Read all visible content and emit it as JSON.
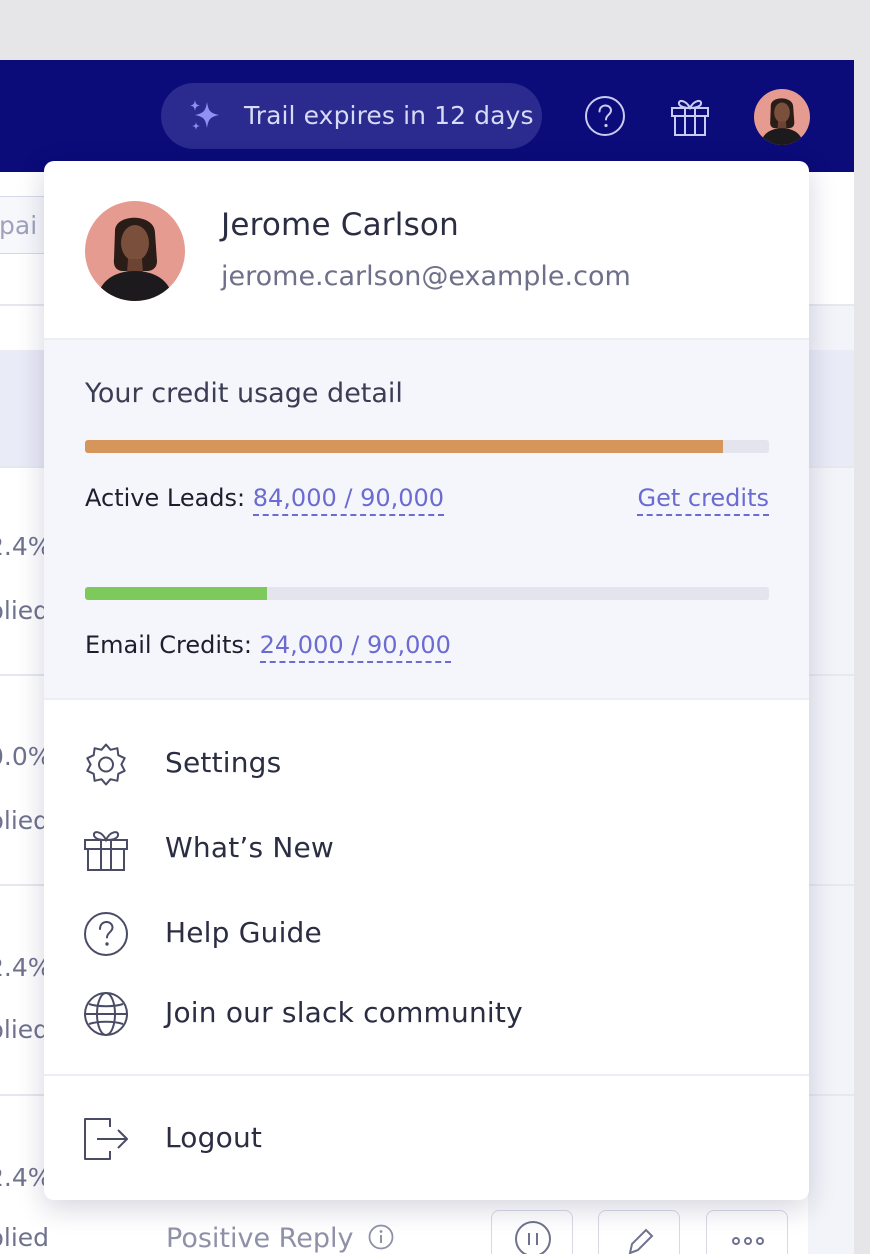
{
  "topbar": {
    "trial_label": "Trail expires in 12 days",
    "help_icon": "help-circle-icon",
    "gift_icon": "gift-icon",
    "colors": {
      "bar": "#0b0b79",
      "pill": "#2a2a8f",
      "sparkle": "#8f8ff5"
    }
  },
  "background": {
    "search_text": "pai",
    "row_texts": [
      "2.4%",
      "plied",
      "0.0%",
      "plied",
      "2.4%",
      "plied",
      "2.4%",
      "plied"
    ],
    "status_label": "Positive Reply"
  },
  "user": {
    "name": "Jerome Carlson",
    "email": "jerome.carlson@example.com"
  },
  "credits": {
    "heading": "Your credit usage detail",
    "active_leads": {
      "label": "Active Leads:",
      "value": "84,000 / 90,000",
      "used": 84000,
      "total": 90000,
      "color": "#d6955a"
    },
    "get_credits_label": "Get credits",
    "email_credits": {
      "label": "Email Credits:",
      "value": "24,000 / 90,000",
      "used": 24000,
      "total": 90000,
      "color": "#7ec95c"
    }
  },
  "menu": {
    "items": [
      {
        "label": "Settings",
        "icon": "gear-icon"
      },
      {
        "label": "What’s New",
        "icon": "gift-icon"
      },
      {
        "label": "Help Guide",
        "icon": "help-circle-icon"
      },
      {
        "label": "Join our slack community",
        "icon": "globe-icon"
      }
    ],
    "logout": {
      "label": "Logout",
      "icon": "logout-icon"
    }
  }
}
